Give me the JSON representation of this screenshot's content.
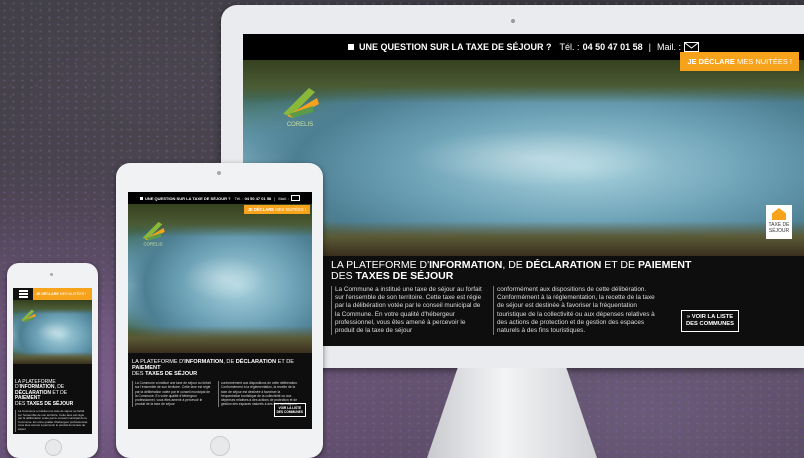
{
  "site": {
    "topbar": {
      "question": "UNE QUESTION SUR LA TAXE DE SÉJOUR ?",
      "tel_label": "Tél. :",
      "tel_number": "04 50 47 01 58",
      "separator": "|",
      "mail_label": "Mail. :"
    },
    "cta": {
      "strong": "JE DÉCLARE",
      "light": " MES NUITÉES !"
    },
    "logo_name": "CORELIS",
    "taxe_badge": {
      "line1": "TAXE DE",
      "line2": "SÉJOUR"
    },
    "title": {
      "p1": "LA PLATEFORME D'",
      "b1": "INFORMATION",
      "p2": ", DE ",
      "b2": "DÉCLARATION",
      "p3": " ET DE ",
      "b3": "PAIEMENT",
      "p4": "DES ",
      "b4": "TAXES DE SÉJOUR"
    },
    "col1": "La Commune  a institué une taxe de séjour au forfait sur l'ensemble de son territoire. Cette taxe est régie par la délibération votée par le conseil municipal de la Commune. En votre qualité d'hébergeur professionnel, vous êtes amené à percevoir le produit de la taxe de séjour",
    "col2": "conformément aux dispositions de cette délibération. Conformément à la réglementation, la recette de la taxe de séjour est destinée à favoriser la fréquentation touristique de la collectivité ou aux dépenses relatives à des actions de protection et de gestion des espaces naturels à des fins touristiques.",
    "list_button": {
      "prefix": "» ",
      "line1": "VOIR LA LISTE",
      "line2": "DES COMMUNES"
    }
  },
  "colors": {
    "accent": "#f7a21b",
    "topbar": "#000000",
    "panel": "#0e0e0e"
  },
  "icons": {
    "mail": "mail-icon",
    "menu": "hamburger-menu-icon",
    "logo": "dragonfly-logo-icon",
    "house": "house-icon"
  }
}
